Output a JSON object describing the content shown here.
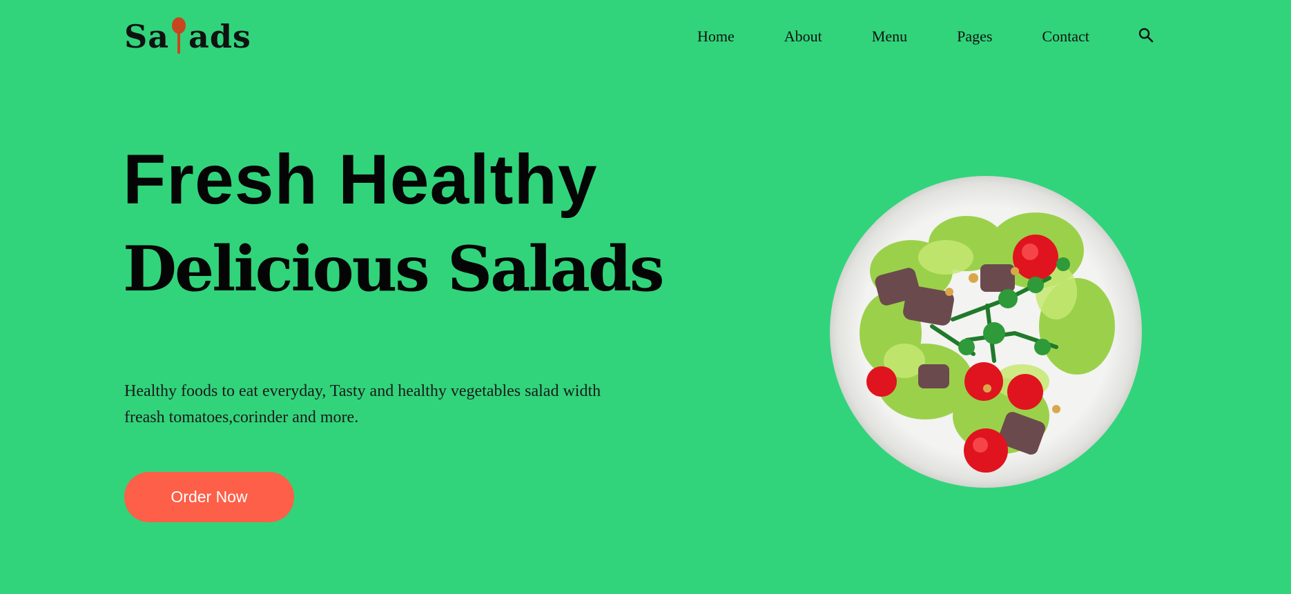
{
  "header": {
    "logo": {
      "prefix": "Sa",
      "suffix": "ads",
      "spoon_icon": "spoon-icon",
      "spoon_color": "#c8461f"
    },
    "nav": [
      {
        "label": "Home"
      },
      {
        "label": "About"
      },
      {
        "label": "Menu"
      },
      {
        "label": "Pages"
      },
      {
        "label": "Contact"
      }
    ],
    "search_icon": "search-icon"
  },
  "hero": {
    "title_line1": "Fresh Healthy",
    "title_line2": "Delicious Salads",
    "description": "Healthy foods to eat everyday, Tasty and healthy vegetables salad width freash tomatoes,corinder and more.",
    "cta_label": "Order Now",
    "image_icon": "salad-plate-image"
  },
  "colors": {
    "background": "#31d47b",
    "accent": "#fd5f48",
    "text": "#050505"
  }
}
